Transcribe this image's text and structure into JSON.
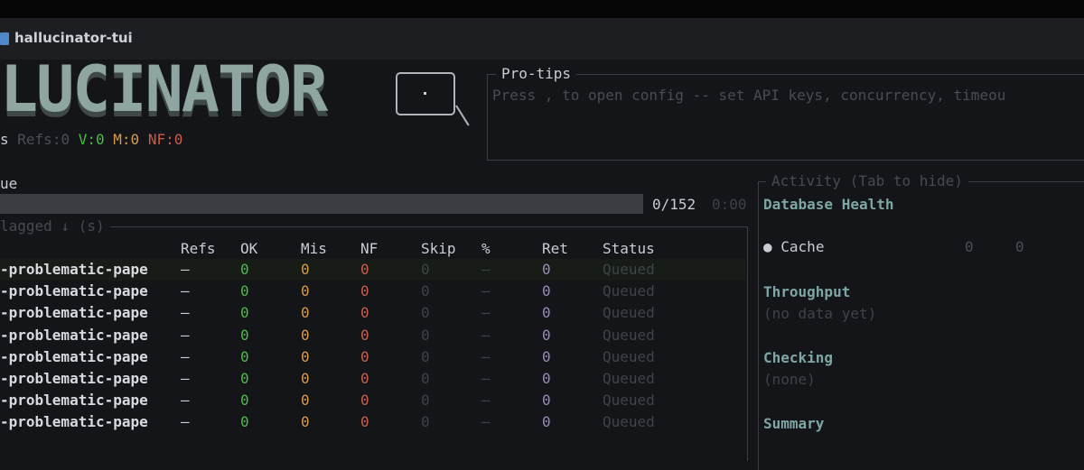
{
  "window": {
    "title": "hallucinator-tui"
  },
  "logo": {
    "text": "LUCINATOR"
  },
  "stats": {
    "prefix": "s",
    "refs_label": "Refs:",
    "refs_value": "0",
    "verified_label": "V:",
    "verified_value": "0",
    "mismatch_label": "M:",
    "mismatch_value": "0",
    "notfound_label": "NF:",
    "notfound_value": "0"
  },
  "protips": {
    "title": "Pro-tips",
    "text": "Press , to open config -- set API keys, concurrency, timeou"
  },
  "queue": {
    "label": "ue",
    "progress_text": "0/152",
    "elapsed": "0:00",
    "progress_fraction": 0,
    "filter_label": "lagged ↓ (s)"
  },
  "table": {
    "columns": [
      "Refs",
      "OK",
      "Mis",
      "NF",
      "Skip",
      "%",
      "Ret",
      "Status"
    ],
    "rows": [
      {
        "name": "-problematic-pape",
        "refs": "—",
        "ok": "0",
        "mis": "0",
        "nf": "0",
        "skip": "0",
        "pct": "—",
        "ret": "0",
        "status": "Queued"
      },
      {
        "name": "-problematic-pape",
        "refs": "—",
        "ok": "0",
        "mis": "0",
        "nf": "0",
        "skip": "0",
        "pct": "—",
        "ret": "0",
        "status": "Queued"
      },
      {
        "name": "-problematic-pape",
        "refs": "—",
        "ok": "0",
        "mis": "0",
        "nf": "0",
        "skip": "0",
        "pct": "—",
        "ret": "0",
        "status": "Queued"
      },
      {
        "name": "-problematic-pape",
        "refs": "—",
        "ok": "0",
        "mis": "0",
        "nf": "0",
        "skip": "0",
        "pct": "—",
        "ret": "0",
        "status": "Queued"
      },
      {
        "name": "-problematic-pape",
        "refs": "—",
        "ok": "0",
        "mis": "0",
        "nf": "0",
        "skip": "0",
        "pct": "—",
        "ret": "0",
        "status": "Queued"
      },
      {
        "name": "-problematic-pape",
        "refs": "—",
        "ok": "0",
        "mis": "0",
        "nf": "0",
        "skip": "0",
        "pct": "—",
        "ret": "0",
        "status": "Queued"
      },
      {
        "name": "-problematic-pape",
        "refs": "—",
        "ok": "0",
        "mis": "0",
        "nf": "0",
        "skip": "0",
        "pct": "—",
        "ret": "0",
        "status": "Queued"
      },
      {
        "name": "-problematic-pape",
        "refs": "—",
        "ok": "0",
        "mis": "0",
        "nf": "0",
        "skip": "0",
        "pct": "—",
        "ret": "0",
        "status": "Queued"
      }
    ]
  },
  "activity": {
    "title": "Activity (Tab to hide)",
    "db_health": "Database Health",
    "cache_label": "Cache",
    "cache_values": [
      "0",
      "0"
    ],
    "throughput_title": "Throughput",
    "throughput_text": "(no data yet)",
    "checking_title": "Checking",
    "checking_text": "(none)",
    "summary_title": "Summary"
  },
  "colors": {
    "background": "#141518",
    "ok": "#4cbb49",
    "mismatch": "#d79b49",
    "notfound": "#cf5a49",
    "retry": "#9c8ab6",
    "accent": "#7ea6a5"
  }
}
